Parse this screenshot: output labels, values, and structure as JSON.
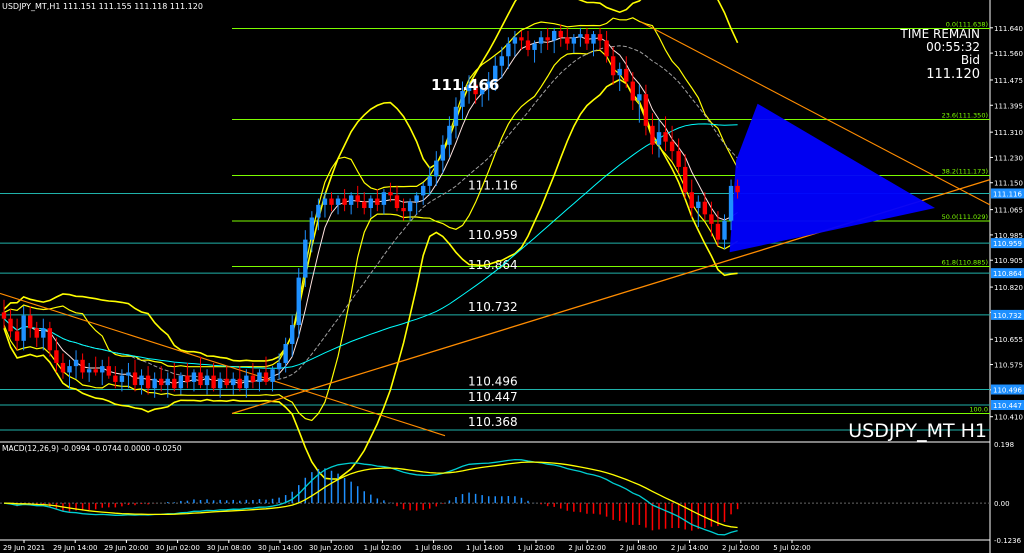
{
  "header": {
    "symbol_info": "USDJPY_MT,H1  111.151 111.155 111.118 111.120",
    "watermark": "USDJPY_MT H1"
  },
  "info_panel": {
    "time_remain_label": "TIME REMAIN",
    "time_remain": "00:55:32",
    "bid_label": "Bid",
    "bid": "111.120"
  },
  "colors": {
    "bull": "#1e90ff",
    "bear": "#ff0000",
    "bollinger": "#ffff00",
    "fib": "#7cfc00",
    "ma_cyan": "#00ffff",
    "trend": "#ff8c00",
    "triangle": "#0000ff",
    "macd_main": "#00ced1",
    "macd_signal": "#ffff00"
  },
  "chart_data": {
    "type": "candlestick",
    "symbol": "USDJPY_MT",
    "timeframe": "H1",
    "ylim": [
      110.33,
      111.69
    ],
    "y_ticks": [
      "111.640",
      "111.560",
      "111.475",
      "111.395",
      "111.310",
      "111.230",
      "111.150",
      "111.065",
      "110.985",
      "110.905",
      "110.820",
      "110.740",
      "110.655",
      "110.575",
      "110.495",
      "110.410"
    ],
    "x_ticks": [
      "29 Jun 2021",
      "29 Jun 14:00",
      "29 Jun 20:00",
      "30 Jun 02:00",
      "30 Jun 08:00",
      "30 Jun 14:00",
      "30 Jun 20:00",
      "1 Jul 02:00",
      "1 Jul 08:00",
      "1 Jul 14:00",
      "1 Jul 20:00",
      "2 Jul 02:00",
      "2 Jul 08:00",
      "2 Jul 14:00",
      "2 Jul 20:00",
      "5 Jul 02:00"
    ],
    "candles": [
      [
        110.74,
        110.78,
        110.69,
        110.72
      ],
      [
        110.72,
        110.75,
        110.66,
        110.68
      ],
      [
        110.68,
        110.72,
        110.62,
        110.65
      ],
      [
        110.65,
        110.76,
        110.62,
        110.73
      ],
      [
        110.73,
        110.76,
        110.66,
        110.69
      ],
      [
        110.69,
        110.71,
        110.63,
        110.66
      ],
      [
        110.66,
        110.72,
        110.62,
        110.69
      ],
      [
        110.69,
        110.71,
        110.6,
        110.62
      ],
      [
        110.62,
        110.66,
        110.55,
        110.58
      ],
      [
        110.58,
        110.61,
        110.53,
        110.55
      ],
      [
        110.55,
        110.59,
        110.5,
        110.57
      ],
      [
        110.57,
        110.62,
        110.53,
        110.59
      ],
      [
        110.59,
        110.61,
        110.53,
        110.55
      ],
      [
        110.55,
        110.58,
        110.52,
        110.56
      ],
      [
        110.56,
        110.6,
        110.54,
        110.55
      ],
      [
        110.55,
        110.59,
        110.51,
        110.57
      ],
      [
        110.57,
        110.6,
        110.53,
        110.54
      ],
      [
        110.54,
        110.57,
        110.5,
        110.52
      ],
      [
        110.52,
        110.56,
        110.49,
        110.54
      ],
      [
        110.54,
        110.58,
        110.5,
        110.55
      ],
      [
        110.55,
        110.59,
        110.49,
        110.51
      ],
      [
        110.51,
        110.56,
        110.48,
        110.54
      ],
      [
        110.54,
        110.57,
        110.48,
        110.5
      ],
      [
        110.5,
        110.55,
        110.47,
        110.53
      ],
      [
        110.53,
        110.57,
        110.49,
        110.51
      ],
      [
        110.51,
        110.55,
        110.47,
        110.53
      ],
      [
        110.53,
        110.58,
        110.49,
        110.5
      ],
      [
        110.5,
        110.55,
        110.48,
        110.54
      ],
      [
        110.54,
        110.58,
        110.5,
        110.52
      ],
      [
        110.52,
        110.56,
        110.49,
        110.55
      ],
      [
        110.55,
        110.6,
        110.5,
        110.51
      ],
      [
        110.51,
        110.56,
        110.48,
        110.54
      ],
      [
        110.54,
        110.58,
        110.49,
        110.5
      ],
      [
        110.5,
        110.55,
        110.47,
        110.53
      ],
      [
        110.53,
        110.57,
        110.5,
        110.51
      ],
      [
        110.51,
        110.55,
        110.48,
        110.53
      ],
      [
        110.53,
        110.57,
        110.49,
        110.5
      ],
      [
        110.5,
        110.56,
        110.47,
        110.54
      ],
      [
        110.54,
        110.58,
        110.5,
        110.52
      ],
      [
        110.52,
        110.56,
        110.49,
        110.55
      ],
      [
        110.55,
        110.6,
        110.51,
        110.52
      ],
      [
        110.52,
        110.57,
        110.49,
        110.56
      ],
      [
        110.56,
        110.61,
        110.53,
        110.58
      ],
      [
        110.58,
        110.66,
        110.55,
        110.64
      ],
      [
        110.64,
        110.73,
        110.6,
        110.7
      ],
      [
        110.7,
        110.88,
        110.66,
        110.85
      ],
      [
        110.85,
        111.0,
        110.82,
        110.97
      ],
      [
        110.97,
        111.06,
        110.93,
        111.04
      ],
      [
        111.04,
        111.1,
        111.0,
        111.08
      ],
      [
        111.08,
        111.12,
        111.04,
        111.1
      ],
      [
        111.1,
        111.12,
        111.06,
        111.08
      ],
      [
        111.08,
        111.11,
        111.05,
        111.1
      ],
      [
        111.1,
        111.13,
        111.06,
        111.08
      ],
      [
        111.08,
        111.12,
        111.05,
        111.11
      ],
      [
        111.11,
        111.14,
        111.07,
        111.09
      ],
      [
        111.09,
        111.12,
        111.05,
        111.07
      ],
      [
        111.07,
        111.11,
        111.04,
        111.1
      ],
      [
        111.1,
        111.13,
        111.06,
        111.08
      ],
      [
        111.08,
        111.13,
        111.05,
        111.12
      ],
      [
        111.12,
        111.15,
        111.09,
        111.11
      ],
      [
        111.11,
        111.14,
        111.06,
        111.07
      ],
      [
        111.07,
        111.1,
        111.03,
        111.06
      ],
      [
        111.06,
        111.1,
        111.03,
        111.09
      ],
      [
        111.09,
        111.12,
        111.05,
        111.11
      ],
      [
        111.11,
        111.15,
        111.08,
        111.14
      ],
      [
        111.14,
        111.2,
        111.11,
        111.17
      ],
      [
        111.17,
        111.25,
        111.14,
        111.22
      ],
      [
        111.22,
        111.3,
        111.18,
        111.27
      ],
      [
        111.27,
        111.36,
        111.23,
        111.33
      ],
      [
        111.33,
        111.42,
        111.29,
        111.39
      ],
      [
        111.39,
        111.47,
        111.35,
        111.44
      ],
      [
        111.44,
        111.49,
        111.4,
        111.46
      ],
      [
        111.46,
        111.48,
        111.4,
        111.43
      ],
      [
        111.43,
        111.47,
        111.39,
        111.45
      ],
      [
        111.45,
        111.5,
        111.41,
        111.47
      ],
      [
        111.47,
        111.55,
        111.44,
        111.52
      ],
      [
        111.52,
        111.58,
        111.48,
        111.55
      ],
      [
        111.55,
        111.61,
        111.51,
        111.59
      ],
      [
        111.59,
        111.63,
        111.55,
        111.61
      ],
      [
        111.61,
        111.63,
        111.57,
        111.6
      ],
      [
        111.6,
        111.63,
        111.55,
        111.57
      ],
      [
        111.57,
        111.6,
        111.53,
        111.59
      ],
      [
        111.59,
        111.63,
        111.56,
        111.61
      ],
      [
        111.61,
        111.64,
        111.57,
        111.6
      ],
      [
        111.6,
        111.64,
        111.56,
        111.63
      ],
      [
        111.63,
        111.65,
        111.58,
        111.61
      ],
      [
        111.61,
        111.64,
        111.57,
        111.59
      ],
      [
        111.59,
        111.62,
        111.56,
        111.61
      ],
      [
        111.61,
        111.64,
        111.58,
        111.62
      ],
      [
        111.62,
        111.64,
        111.57,
        111.59
      ],
      [
        111.59,
        111.63,
        111.55,
        111.62
      ],
      [
        111.62,
        111.64,
        111.57,
        111.6
      ],
      [
        111.6,
        111.63,
        111.53,
        111.55
      ],
      [
        111.55,
        111.58,
        111.46,
        111.49
      ],
      [
        111.49,
        111.53,
        111.44,
        111.51
      ],
      [
        111.51,
        111.55,
        111.45,
        111.47
      ],
      [
        111.47,
        111.5,
        111.38,
        111.41
      ],
      [
        111.41,
        111.46,
        111.34,
        111.43
      ],
      [
        111.43,
        111.46,
        111.3,
        111.33
      ],
      [
        111.33,
        111.37,
        111.24,
        111.27
      ],
      [
        111.27,
        111.35,
        111.23,
        111.31
      ],
      [
        111.31,
        111.36,
        111.25,
        111.28
      ],
      [
        111.28,
        111.33,
        111.22,
        111.25
      ],
      [
        111.25,
        111.29,
        111.18,
        111.2
      ],
      [
        111.2,
        111.24,
        111.1,
        111.12
      ],
      [
        111.12,
        111.16,
        111.04,
        111.07
      ],
      [
        111.07,
        111.11,
        111.01,
        111.09
      ],
      [
        111.09,
        111.12,
        111.03,
        111.05
      ],
      [
        111.05,
        111.09,
        110.98,
        111.02
      ],
      [
        111.02,
        111.06,
        110.95,
        110.97
      ],
      [
        110.97,
        111.05,
        110.94,
        111.03
      ],
      [
        111.03,
        111.16,
        111.0,
        111.14
      ],
      [
        111.14,
        111.16,
        111.1,
        111.12
      ]
    ],
    "labeled_levels": [
      {
        "value": 111.116,
        "label": "111.116"
      },
      {
        "value": 110.959,
        "label": "110.959"
      },
      {
        "value": 110.864,
        "label": "110.864"
      },
      {
        "value": 110.732,
        "label": "110.732"
      },
      {
        "value": 110.496,
        "label": "110.496"
      },
      {
        "value": 110.447,
        "label": "110.447"
      },
      {
        "value": 110.368,
        "label": "110.368"
      }
    ],
    "price_tags": [
      "111.116",
      "110.959",
      "110.864",
      "110.732",
      "110.496",
      "110.447"
    ],
    "fib_levels": [
      {
        "value": 111.638,
        "label": "0.0(111.638)"
      },
      {
        "value": 111.35,
        "label": "23.6(111.350)"
      },
      {
        "value": 111.173,
        "label": "38.2(111.173)"
      },
      {
        "value": 111.029,
        "label": "50.0(111.029)"
      },
      {
        "value": 110.885,
        "label": "61.8(110.885)"
      },
      {
        "value": 110.42,
        "label": "100.0"
      }
    ],
    "annotation": {
      "text": "111.466",
      "value": 111.466,
      "at_candle": 71
    },
    "macd": {
      "label": "MACD(12,26,9) -0.0994 -0.0744 0.0000 -0.0250",
      "params": "12,26,9",
      "ylim": [
        -0.1236,
        0.198
      ],
      "y_ticks": [
        "0.198",
        "0.00",
        "-0.1236"
      ]
    }
  }
}
